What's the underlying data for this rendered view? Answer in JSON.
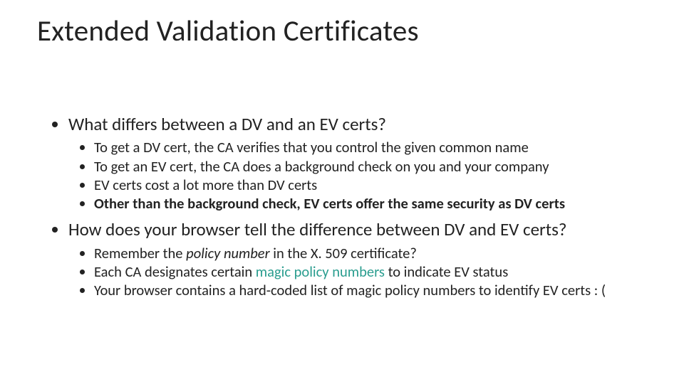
{
  "title": "Extended Validation Certificates",
  "l1_1": "What differs between a DV and an EV certs?",
  "l2_1a": "To get a DV cert, the CA verifies that you control the given common name",
  "l2_1b": "To get an EV cert, the CA does a background check on you and your company",
  "l2_1c": "EV certs cost a lot more than DV certs",
  "l2_1d": "Other than the background check, EV certs offer the same security as DV certs",
  "l1_2": "How does your browser tell the difference between DV and EV certs?",
  "l2_2a_part1": "Remember the ",
  "l2_2a_italic": "policy number",
  "l2_2a_part2": " in the X. 509 certificate?",
  "l2_2b_part1": "Each CA designates certain ",
  "l2_2b_teal": "magic policy numbers",
  "l2_2b_part2": " to indicate EV status",
  "l2_2c": "Your browser contains a hard-coded list of magic policy numbers to identify EV certs : ("
}
